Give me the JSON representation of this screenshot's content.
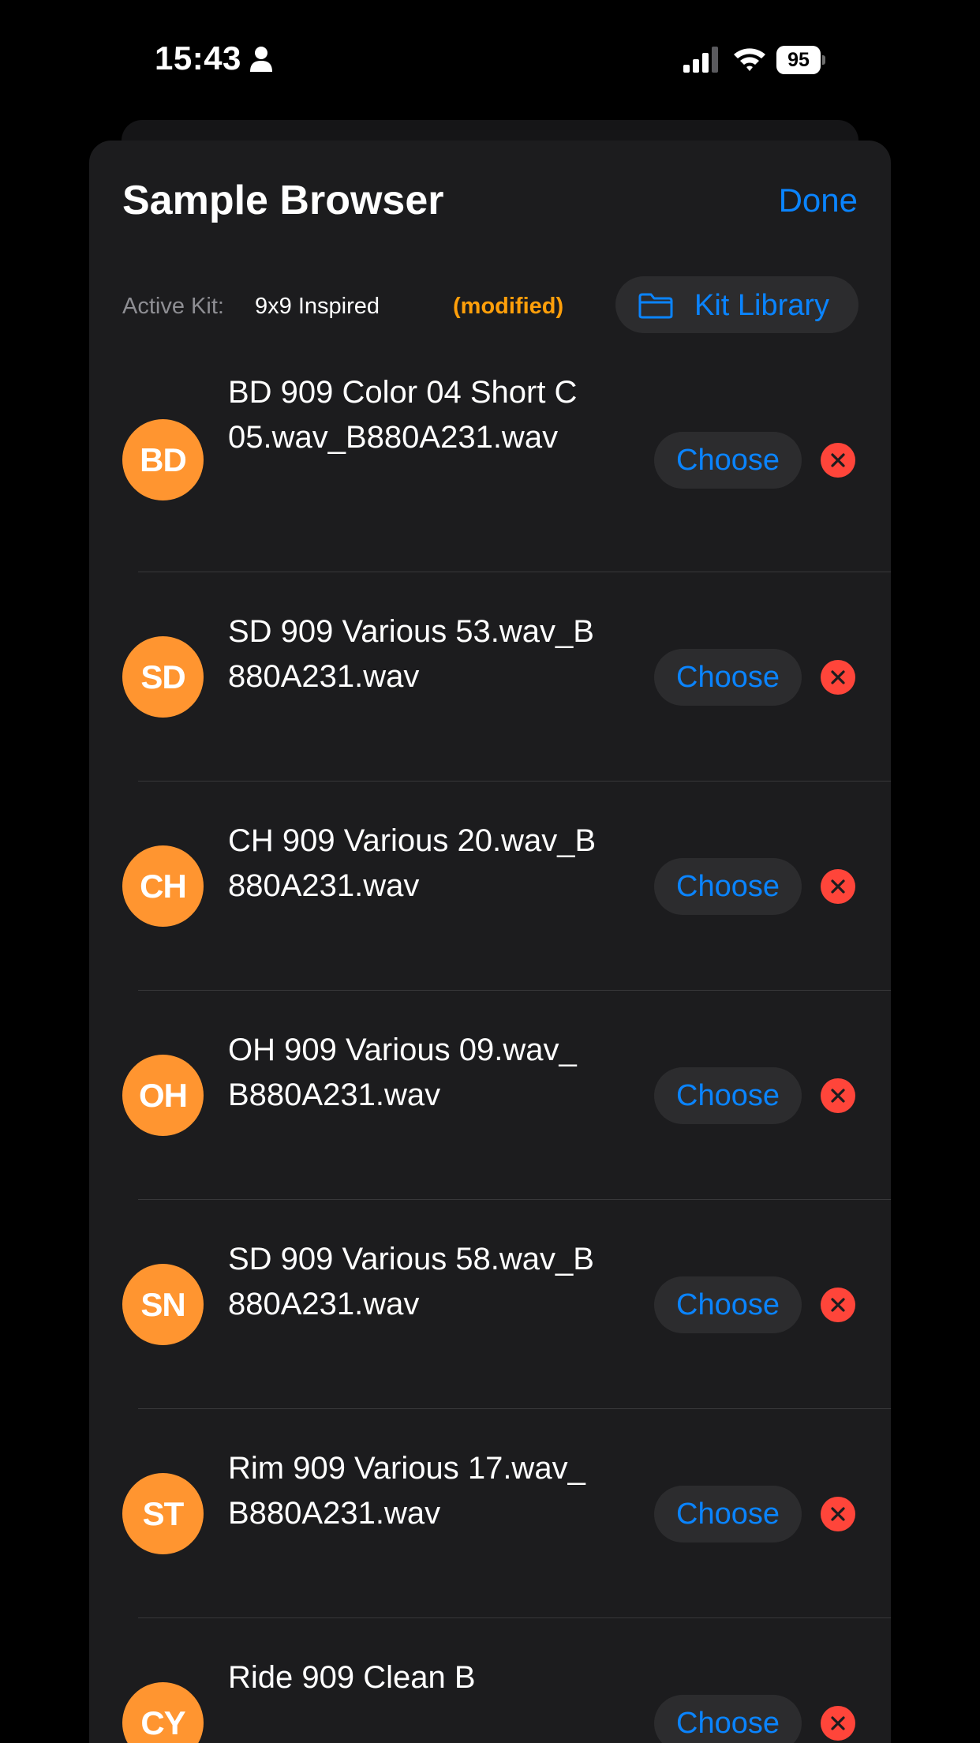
{
  "status_bar": {
    "time": "15:43",
    "battery": "95",
    "icons": [
      "person-icon",
      "signal-icon",
      "wifi-icon",
      "battery-icon"
    ]
  },
  "sheet": {
    "title": "Sample Browser",
    "done_label": "Done"
  },
  "kit": {
    "label": "Active Kit:",
    "name": "9x9 Inspired",
    "modified": "(modified)",
    "library_label": "Kit Library"
  },
  "samples": [
    {
      "badge": "BD",
      "name": "BD 909 Color 04 Short C 05.wav_B880A231.wav",
      "choose_label": "Choose"
    },
    {
      "badge": "SD",
      "name": "SD 909 Various 53.wav_B880A231.wav",
      "choose_label": "Choose"
    },
    {
      "badge": "CH",
      "name": "CH 909 Various 20.wav_B880A231.wav",
      "choose_label": "Choose"
    },
    {
      "badge": "OH",
      "name": "OH 909 Various 09.wav_B880A231.wav",
      "choose_label": "Choose"
    },
    {
      "badge": "SN",
      "name": "SD 909 Various 58.wav_B880A231.wav",
      "choose_label": "Choose"
    },
    {
      "badge": "ST",
      "name": "Rim 909 Various 17.wav_B880A231.wav",
      "choose_label": "Choose"
    },
    {
      "badge": "CY",
      "name": "Ride 909 Clean B",
      "choose_label": "Choose"
    }
  ],
  "colors": {
    "background": "#000000",
    "sheet": "#1c1c1e",
    "accent": "#0a84ff",
    "badge": "#ff9530",
    "modified": "#ff9f0a",
    "remove": "#ff453a"
  }
}
